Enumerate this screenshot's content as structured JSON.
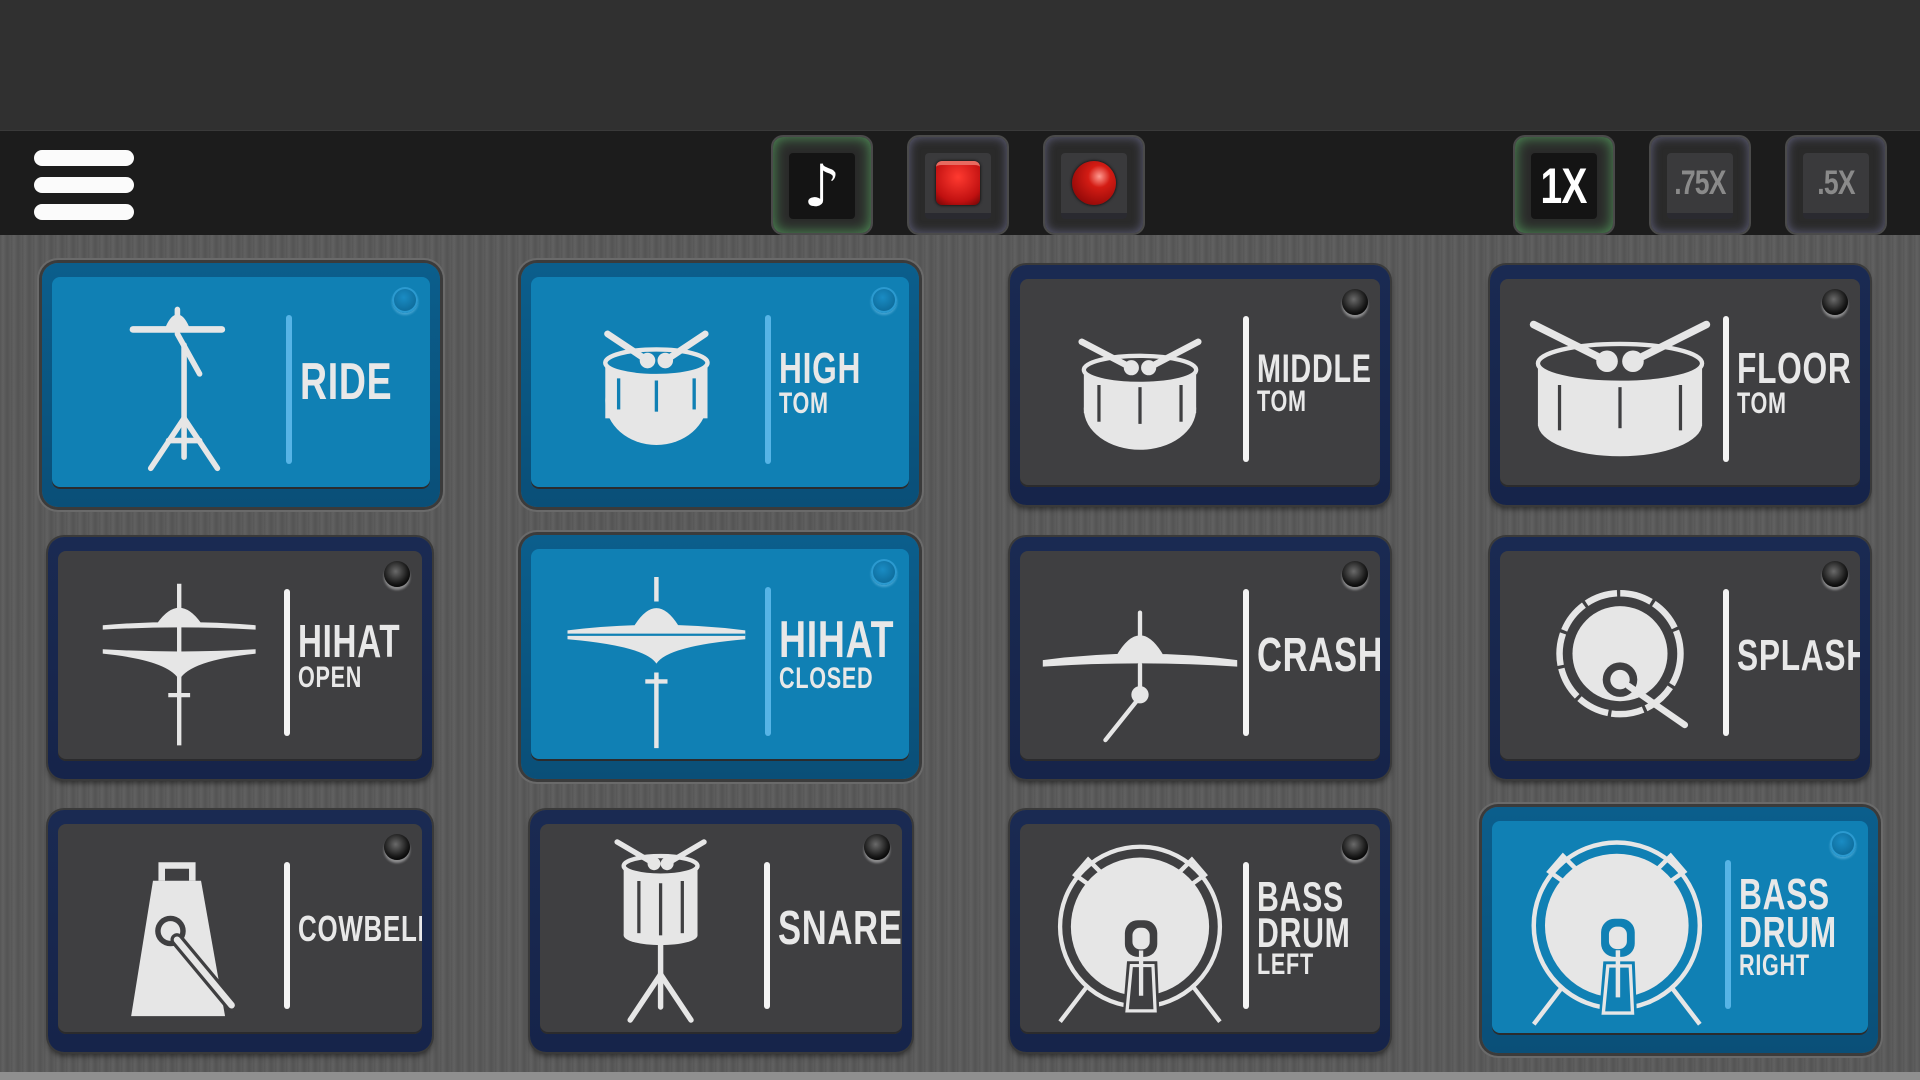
{
  "toolbar": {
    "menu_icon": "hamburger-menu-icon",
    "transport": [
      {
        "id": "play-rhythm",
        "icon": "music-note-icon",
        "glyph": "♪",
        "active": true
      },
      {
        "id": "stop",
        "icon": "stop-icon",
        "active": false
      },
      {
        "id": "record",
        "icon": "record-icon",
        "active": false
      }
    ],
    "speed": [
      {
        "label": "1X",
        "active": true
      },
      {
        "label": ".75X",
        "active": false
      },
      {
        "label": ".5X",
        "active": false
      }
    ]
  },
  "colors": {
    "active_pad": "#1080b4",
    "inactive_pad": "#3f3f41",
    "pad_border": "#16244a",
    "toolbar_bg": "#1c1c1c",
    "status_bar_bg": "#303030",
    "active_button_glow": "#5aaa64",
    "record_red": "#d41c14"
  },
  "pads": [
    {
      "name": "RIDE",
      "sub": "",
      "icon": "ride-cymbal-icon",
      "active": true
    },
    {
      "name": "HIGH",
      "sub": "TOM",
      "icon": "high-tom-icon",
      "active": true
    },
    {
      "name": "MIDDLE",
      "sub": "TOM",
      "icon": "middle-tom-icon",
      "active": false
    },
    {
      "name": "FLOOR",
      "sub": "TOM",
      "icon": "floor-tom-icon",
      "active": false
    },
    {
      "name": "HIHAT",
      "sub": "OPEN",
      "icon": "hihat-open-icon",
      "active": false
    },
    {
      "name": "HIHAT",
      "sub": "CLOSED",
      "icon": "hihat-closed-icon",
      "active": true
    },
    {
      "name": "CRASH",
      "sub": "",
      "icon": "crash-cymbal-icon",
      "active": false
    },
    {
      "name": "SPLASH",
      "sub": "",
      "icon": "splash-cymbal-icon",
      "active": false
    },
    {
      "name": "COWBELL",
      "sub": "",
      "icon": "cowbell-icon",
      "active": false
    },
    {
      "name": "SNARE",
      "sub": "",
      "icon": "snare-drum-icon",
      "active": false
    },
    {
      "name": "BASS DRUM",
      "sub": "LEFT",
      "icon": "bass-drum-left-icon",
      "active": false
    },
    {
      "name": "BASS DRUM",
      "sub": "RIGHT",
      "icon": "bass-drum-right-icon",
      "active": true
    }
  ]
}
